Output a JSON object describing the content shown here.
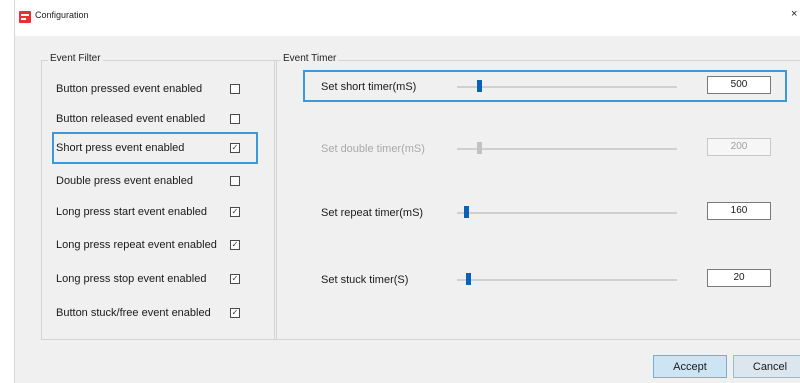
{
  "window": {
    "title": "Configuration",
    "close_glyph": "×",
    "icon": "app-logo-icon"
  },
  "event_filter": {
    "legend": "Event Filter",
    "items": [
      {
        "label": "Button pressed event enabled",
        "checked": false
      },
      {
        "label": "Button released event enabled",
        "checked": false
      },
      {
        "label": "Short press event enabled",
        "checked": true,
        "focused": true
      },
      {
        "label": "Double press event enabled",
        "checked": false
      },
      {
        "label": "Long press start event enabled",
        "checked": true
      },
      {
        "label": "Long press repeat event enabled",
        "checked": true
      },
      {
        "label": "Long press stop event enabled",
        "checked": true
      },
      {
        "label": "Button stuck/free event enabled",
        "checked": true
      }
    ]
  },
  "event_timer": {
    "legend": "Event Timer",
    "rows": [
      {
        "label": "Set short timer(mS)",
        "value": "500",
        "slider_fraction": 0.1,
        "enabled": true,
        "focused": true
      },
      {
        "label": "Set double timer(mS)",
        "value": "200",
        "slider_fraction": 0.1,
        "enabled": false
      },
      {
        "label": "Set repeat timer(mS)",
        "value": "160",
        "slider_fraction": 0.04,
        "enabled": true
      },
      {
        "label": "Set stuck timer(S)",
        "value": "20",
        "slider_fraction": 0.05,
        "enabled": true
      }
    ]
  },
  "buttons": {
    "accept": "Accept",
    "cancel": "Cancel"
  },
  "colors": {
    "focus": "#3a9ad9",
    "slider_thumb": "#0a62b8",
    "accent_button": "#cde4f4",
    "app_icon": "#e8312f"
  }
}
